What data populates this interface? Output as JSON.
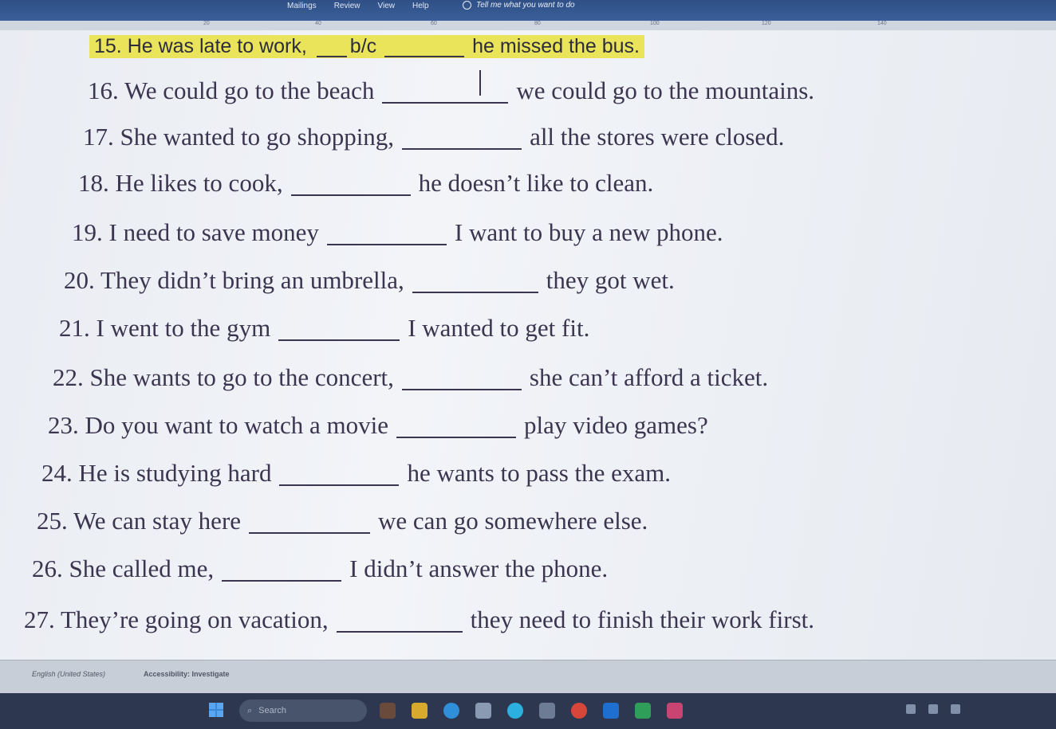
{
  "ribbon": {
    "tabs": [
      "Mailings",
      "Review",
      "View",
      "Help"
    ],
    "tell_me": "Tell me what you want to do"
  },
  "ruler": {
    "marks": [
      "20",
      "40",
      "60",
      "80",
      "100",
      "120",
      "140"
    ]
  },
  "document": {
    "lines": [
      {
        "before": "15. He was late to work,",
        "hint": "b/c",
        "after": "he missed the bus."
      },
      {
        "before": "16. We could go to the beach",
        "after": "we could go to the mountains."
      },
      {
        "before": "17. She wanted to go shopping,",
        "after": "all the stores were closed."
      },
      {
        "before": "18. He likes to cook,",
        "after": "he doesn’t like to clean."
      },
      {
        "before": "19. I need to save money",
        "after": "I want to buy a new phone."
      },
      {
        "before": "20. They didn’t bring an umbrella,",
        "after": "they got wet."
      },
      {
        "before": "21. I went to the gym",
        "after": "I wanted to get fit."
      },
      {
        "before": "22. She wants to go to the concert,",
        "after": "she can’t afford a ticket."
      },
      {
        "before": "23. Do you want to watch a movie",
        "after": "play video games?"
      },
      {
        "before": "24. He is studying hard",
        "after": "he wants to pass the exam."
      },
      {
        "before": "25. We can stay here",
        "after": "we can go somewhere else."
      },
      {
        "before": "26. She called me,",
        "after": "I didn’t answer the phone."
      },
      {
        "before": "27. They’re going on vacation,",
        "after": "they need to finish their work first."
      }
    ]
  },
  "status": {
    "language": "English (United States)",
    "accessibility": "Accessibility: Investigate"
  },
  "taskbar": {
    "search_placeholder": "Search"
  },
  "colors": {
    "highlight": "#e9e45a",
    "text": "#3b3550",
    "taskbar": "#2d3850"
  }
}
